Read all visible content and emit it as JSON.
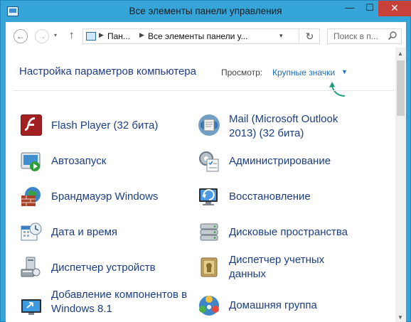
{
  "window": {
    "title": "Все элементы панели управления",
    "minimize_glyph": "—",
    "maximize_glyph": "☐",
    "close_glyph": "✕"
  },
  "address": {
    "back_glyph": "←",
    "forward_glyph": "→",
    "up_glyph": "↑",
    "crumbs": [
      "Пан...",
      "Все элементы панели у..."
    ],
    "refresh_glyph": "↻",
    "search_placeholder": "Поиск в п..."
  },
  "header": {
    "title": "Настройка параметров компьютера",
    "view_label": "Просмотр:",
    "view_value": "Крупные значки"
  },
  "items": [
    {
      "label": "Flash Player (32 бита)",
      "icon": "flash-player-icon"
    },
    {
      "label": "Mail (Microsoft Outlook 2013) (32 бита)",
      "icon": "mail-icon"
    },
    {
      "label": "Автозапуск",
      "icon": "autoplay-icon"
    },
    {
      "label": "Администрирование",
      "icon": "administration-icon"
    },
    {
      "label": "Брандмауэр Windows",
      "icon": "firewall-icon"
    },
    {
      "label": "Восстановление",
      "icon": "recovery-icon"
    },
    {
      "label": "Дата и время",
      "icon": "date-time-icon"
    },
    {
      "label": "Дисковые пространства",
      "icon": "storage-spaces-icon"
    },
    {
      "label": "Диспетчер устройств",
      "icon": "device-manager-icon"
    },
    {
      "label": "Диспетчер учетных данных",
      "icon": "credential-manager-icon"
    },
    {
      "label": "Добавление компонентов в Windows 8.1",
      "icon": "add-features-icon"
    },
    {
      "label": "Домашняя группа",
      "icon": "homegroup-icon"
    }
  ],
  "colors": {
    "titlebar": "#35a4d8",
    "close_button": "#c7403a",
    "link": "#1b3e83",
    "view_link": "#1c6cc7",
    "annotation_arrow": "#1a9c78"
  }
}
